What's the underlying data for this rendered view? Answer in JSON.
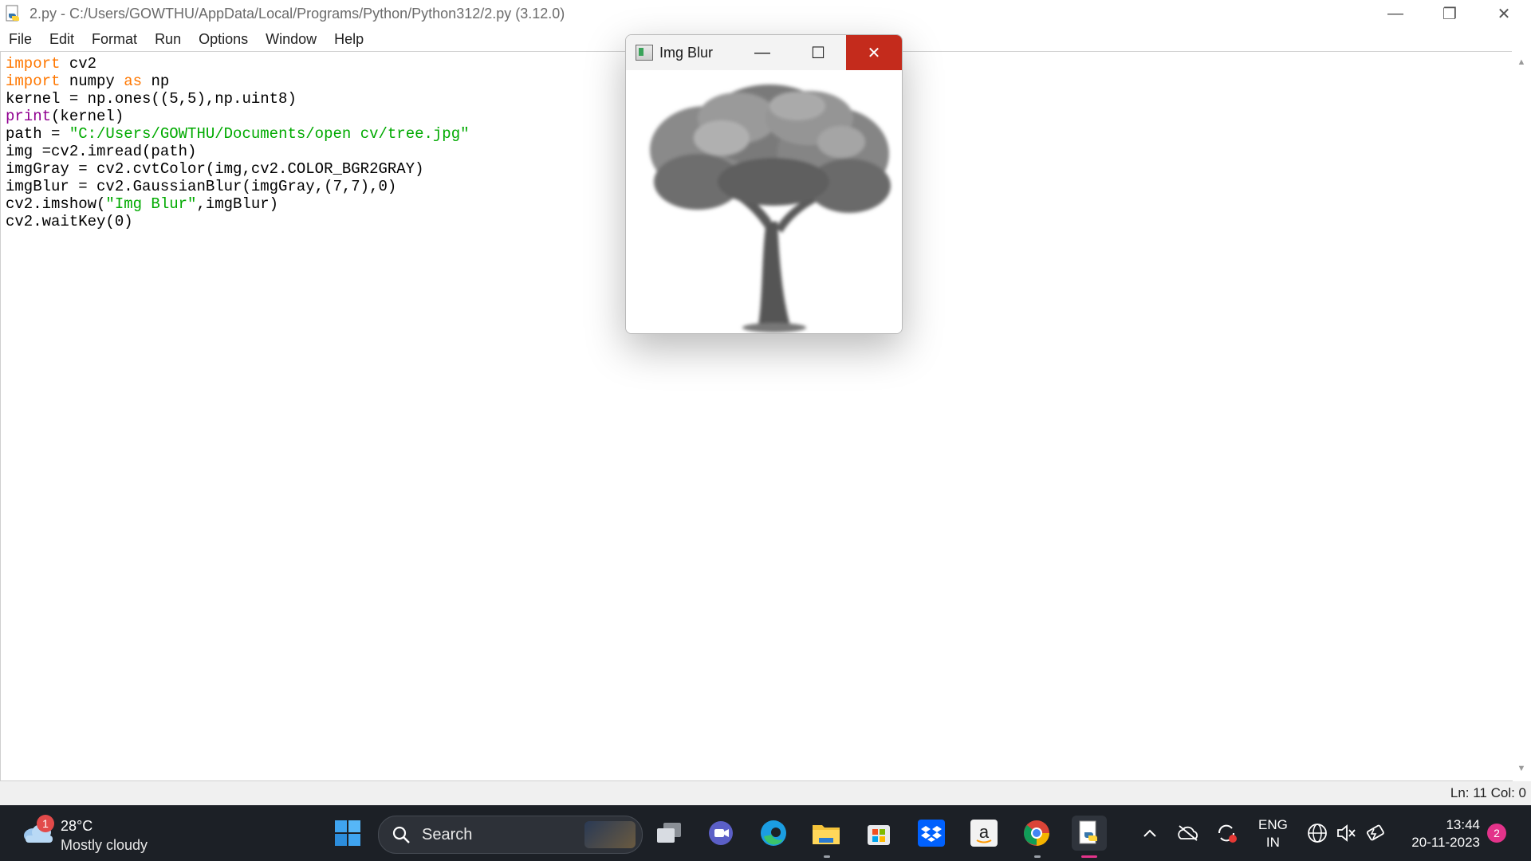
{
  "window": {
    "title": "2.py - C:/Users/GOWTHU/AppData/Local/Programs/Python/Python312/2.py (3.12.0)",
    "minimize": "—",
    "restore": "❐",
    "close": "✕"
  },
  "menu": [
    "File",
    "Edit",
    "Format",
    "Run",
    "Options",
    "Window",
    "Help"
  ],
  "code": {
    "l1_kw": "import",
    "l1_rest": " cv2",
    "l2_kw": "import",
    "l2_mid": " numpy ",
    "l2_as": "as",
    "l2_rest": " np",
    "l3": "kernel = np.ones((5,5),np.uint8)",
    "l4_bi": "print",
    "l4_rest": "(kernel)",
    "l5_pre": "path = ",
    "l5_str": "\"C:/Users/GOWTHU/Documents/open cv/tree.jpg\"",
    "l6": "img =cv2.imread(path)",
    "l7": "imgGray = cv2.cvtColor(img,cv2.COLOR_BGR2GRAY)",
    "l8": "imgBlur = cv2.GaussianBlur(imgGray,(7,7),0)",
    "l9_pre": "cv2.imshow(",
    "l9_str": "\"Img Blur\"",
    "l9_rest": ",imgBlur)",
    "l10": "cv2.waitKey(0)"
  },
  "status": {
    "position": "Ln: 11   Col: 0"
  },
  "popup": {
    "title": "Img Blur",
    "minimize": "—",
    "maximize": "☐",
    "close": "✕"
  },
  "taskbar": {
    "weather": {
      "badge": "1",
      "temp": "28°C",
      "desc": "Mostly cloudy"
    },
    "search_label": "Search",
    "lang_1": "ENG",
    "lang_2": "IN",
    "time": "13:44",
    "date": "20-11-2023",
    "notifications": "2",
    "apps": [
      "start-icon",
      "task-view-icon",
      "teams-icon",
      "edge-icon",
      "file-explorer-icon",
      "store-icon",
      "dropbox-icon",
      "amazon-icon",
      "chrome-icon",
      "python-idle-icon"
    ]
  }
}
